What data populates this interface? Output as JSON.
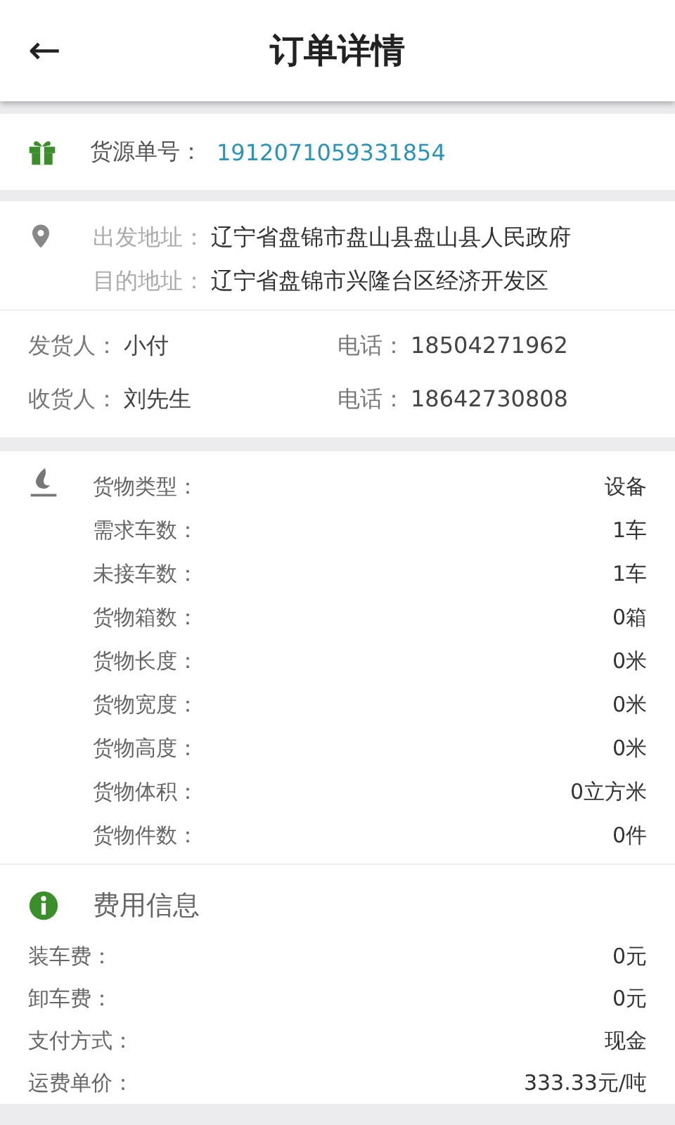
{
  "header": {
    "back": "←",
    "title": "订单详情"
  },
  "order": {
    "label": "货源单号：",
    "number": "1912071059331854"
  },
  "addresses": [
    {
      "label": "出发地址：",
      "value": "辽宁省盘锦市盘山县盘山县人民政府"
    },
    {
      "label": "目的地址：",
      "value": "辽宁省盘锦市兴隆台区经济开发区"
    }
  ],
  "contacts": [
    {
      "label": "发货人：",
      "name": "小付",
      "phone_label": "电话：",
      "phone": "18504271962"
    },
    {
      "label": "收货人：",
      "name": "刘先生",
      "phone_label": "电话：",
      "phone": "18642730808"
    }
  ],
  "cargo": [
    {
      "label": "货物类型：",
      "value": "设备"
    },
    {
      "label": "需求车数：",
      "value": "1车"
    },
    {
      "label": "未接车数：",
      "value": "1车"
    },
    {
      "label": "货物箱数：",
      "value": "0箱"
    },
    {
      "label": "货物长度：",
      "value": "0米"
    },
    {
      "label": "货物宽度：",
      "value": "0米"
    },
    {
      "label": "货物高度：",
      "value": "0米"
    },
    {
      "label": "货物体积：",
      "value": "0立方米"
    },
    {
      "label": "货物件数：",
      "value": "0件"
    }
  ],
  "fees": {
    "title": "费用信息",
    "rows": [
      {
        "label": "装车费：",
        "value": "0元"
      },
      {
        "label": "卸车费：",
        "value": "0元"
      },
      {
        "label": "支付方式：",
        "value": "现金"
      },
      {
        "label": "运费单价：",
        "value": "333.33元/吨"
      }
    ]
  }
}
